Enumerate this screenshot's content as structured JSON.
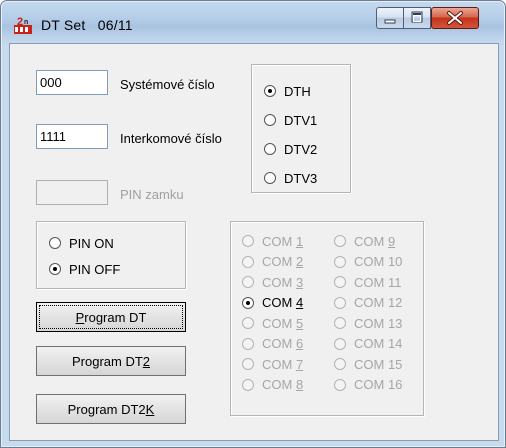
{
  "window": {
    "title": "DT Set",
    "version": "06/11"
  },
  "fields": {
    "system_number": {
      "value": "000",
      "label": "Systémové číslo"
    },
    "intercom_number": {
      "value": "1111",
      "label": "Interkomové číslo"
    },
    "lock_pin": {
      "value": "",
      "label": "PIN zamku"
    }
  },
  "dt_type": {
    "selected": "DTH",
    "options": [
      "DTH",
      "DTV1",
      "DTV2",
      "DTV3"
    ]
  },
  "pin_mode": {
    "selected": "PIN OFF",
    "options": [
      "PIN ON",
      "PIN OFF"
    ]
  },
  "buttons": {
    "program_dt": {
      "pre": "",
      "key": "P",
      "post": "rogram DT"
    },
    "program_dt2": {
      "pre": "Program DT",
      "key": "2",
      "post": ""
    },
    "program_dt2k": {
      "pre": "Program DT2",
      "key": "K",
      "post": ""
    }
  },
  "com_ports": {
    "selected": "COM 4",
    "enabled": [
      "COM 4"
    ],
    "left": [
      {
        "pre": "COM ",
        "key": "1"
      },
      {
        "pre": "COM ",
        "key": "2"
      },
      {
        "pre": "COM ",
        "key": "3"
      },
      {
        "pre": "COM ",
        "key": "4"
      },
      {
        "pre": "COM ",
        "key": "5"
      },
      {
        "pre": "COM ",
        "key": "6"
      },
      {
        "pre": "COM ",
        "key": "7"
      },
      {
        "pre": "COM ",
        "key": "8"
      }
    ],
    "right": [
      {
        "pre": "COM ",
        "key": "9"
      },
      {
        "pre": "COM 10",
        "key": ""
      },
      {
        "pre": "COM 11",
        "key": ""
      },
      {
        "pre": "COM 12",
        "key": ""
      },
      {
        "pre": "COM 13",
        "key": ""
      },
      {
        "pre": "COM 14",
        "key": ""
      },
      {
        "pre": "COM 15",
        "key": ""
      },
      {
        "pre": "COM 16",
        "key": ""
      }
    ]
  },
  "colors": {
    "close_button": "#c5341a",
    "disabled_text": "#a0a0a0",
    "dialog_background": "#f0f0f0"
  }
}
